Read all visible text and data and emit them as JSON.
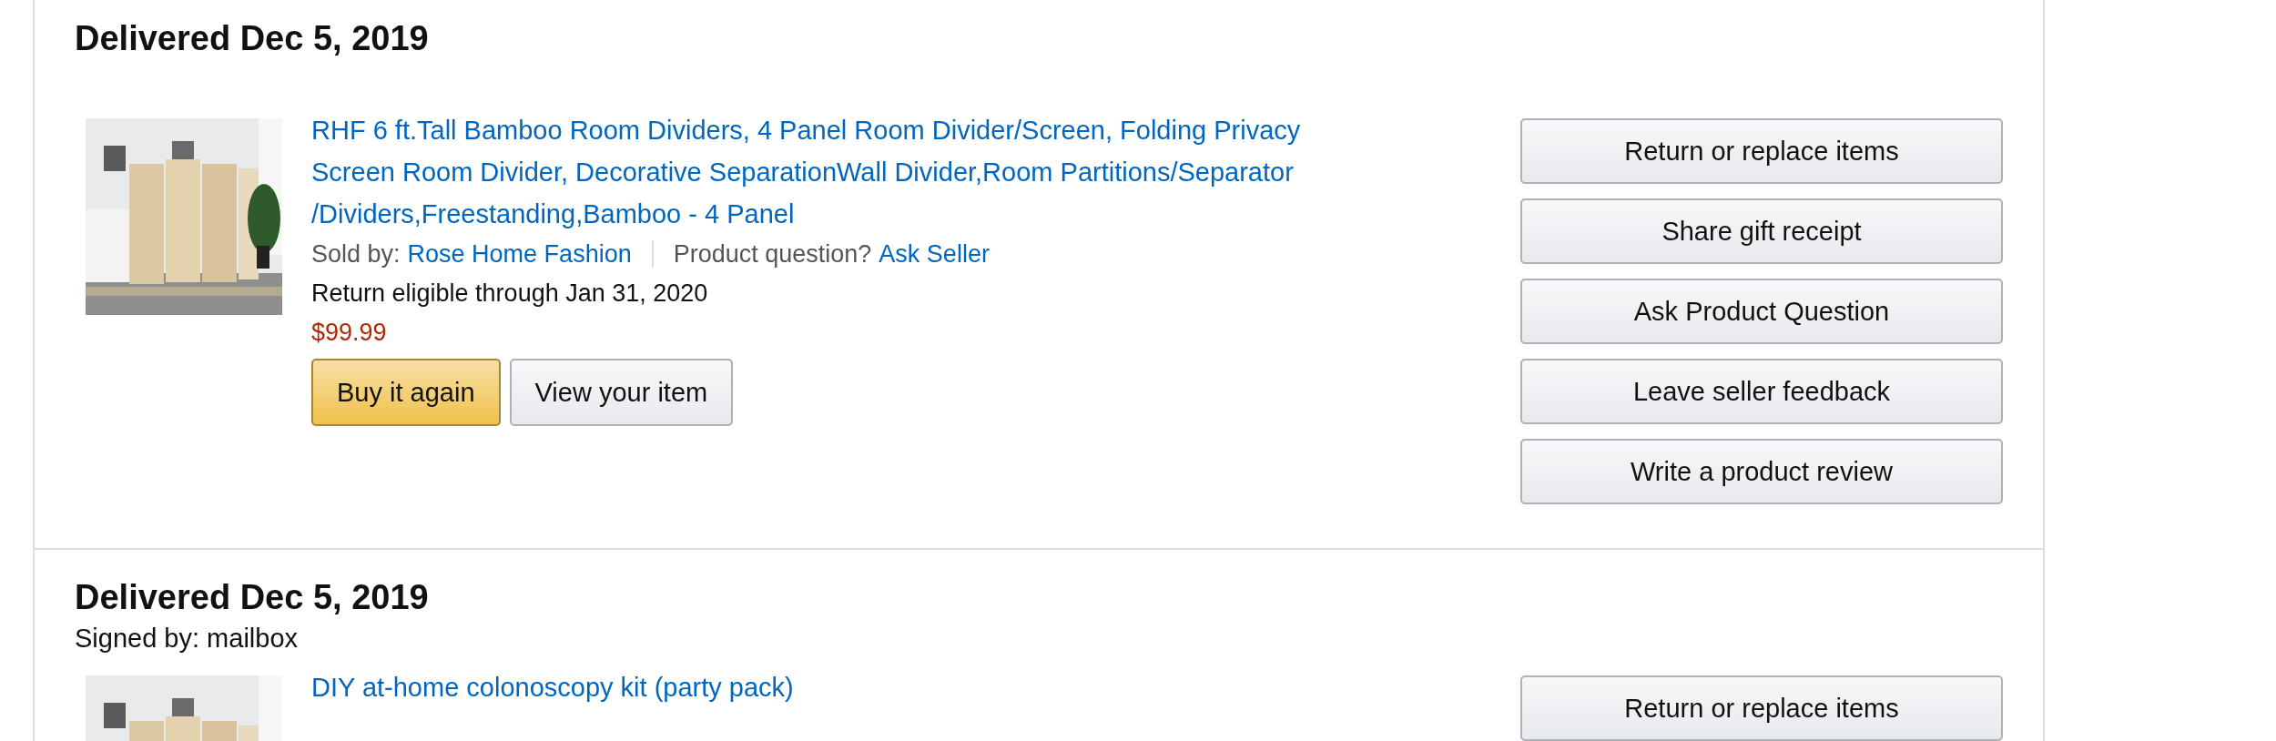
{
  "shipments": [
    {
      "heading": "Delivered Dec 5, 2019",
      "item": {
        "kind": "picture",
        "title": "RHF 6 ft.Tall Bamboo Room Dividers, 4 Panel Room Divider/Screen, Folding Privacy Screen Room Divider, Decorative SeparationWall Divider,Room Partitions/Separator /Dividers,Freestanding,Bamboo - 4 Panel",
        "sold_by_label": "Sold by:",
        "seller": "Rose Home Fashion",
        "question_label": "Product question?",
        "ask_seller": "Ask Seller",
        "return_note": "Return eligible through Jan 31, 2020",
        "price": "$99.99",
        "buy_again": "Buy it again",
        "view_item": "View your item"
      },
      "actions": [
        "Return or replace items",
        "Share gift receipt",
        "Ask Product Question",
        "Leave seller feedback",
        "Write a product review"
      ]
    },
    {
      "heading": "Delivered Dec 5, 2019",
      "signed_by": "Signed by: mailbox",
      "item": {
        "kind": "picture",
        "title": "DIY at-home colonoscopy kit (party pack)"
      },
      "actions": [
        "Return or replace items"
      ]
    }
  ]
}
